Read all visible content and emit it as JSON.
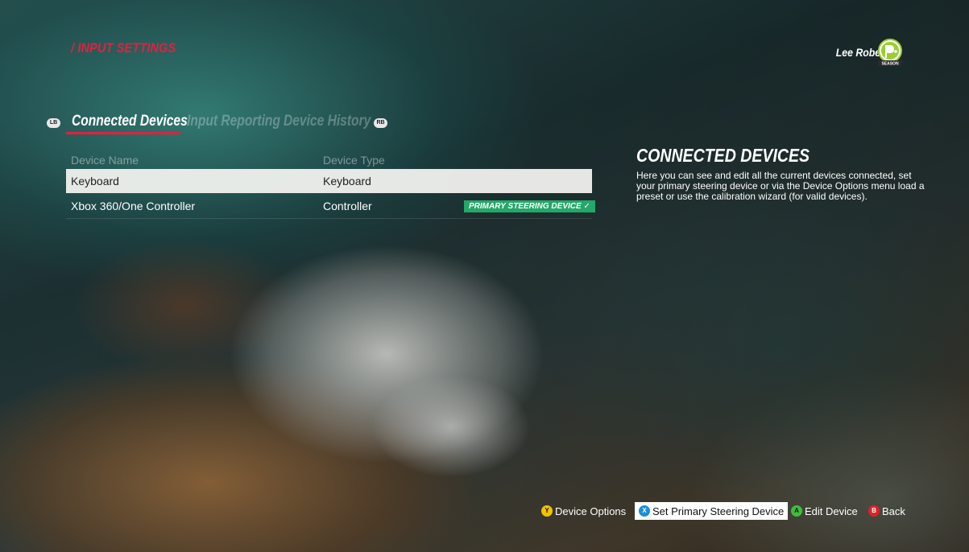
{
  "breadcrumb": "/ INPUT SETTINGS",
  "user": {
    "name": "Lee Roberts",
    "badge_label": "SEASON",
    "badge_color": "#9acd32"
  },
  "tabs": {
    "left_bumper": "LB",
    "right_bumper": "RB",
    "items": [
      {
        "label": "Connected Devices",
        "active": true
      },
      {
        "label": "Input Reporting",
        "active": false
      },
      {
        "label": "Device History",
        "active": false
      }
    ]
  },
  "table": {
    "headers": {
      "name": "Device Name",
      "type": "Device Type"
    },
    "rows": [
      {
        "name": "Keyboard",
        "type": "Keyboard",
        "selected": true,
        "primary": ""
      },
      {
        "name": "Xbox 360/One Controller",
        "type": "Controller",
        "selected": false,
        "primary": "PRIMARY STEERING DEVICE ✓"
      }
    ]
  },
  "panel": {
    "title": "CONNECTED DEVICES",
    "text": "Here you can see and edit all the current devices connected, set your primary steering device or via the Device Options menu load a preset or use the calibration wizard (for valid devices)."
  },
  "footer": {
    "prompts": [
      {
        "button": "Y",
        "color": "#f2c200",
        "label": "Device Options"
      },
      {
        "button": "X",
        "color": "#1a8fd6",
        "label": "Set Primary Steering Device"
      },
      {
        "button": "A",
        "color": "#3cbf3c",
        "label": "Edit Device"
      },
      {
        "button": "B",
        "color": "#e0202a",
        "label": "Back"
      }
    ]
  },
  "colors": {
    "accent": "#e3203f",
    "primary_badge": "#23a86a"
  }
}
